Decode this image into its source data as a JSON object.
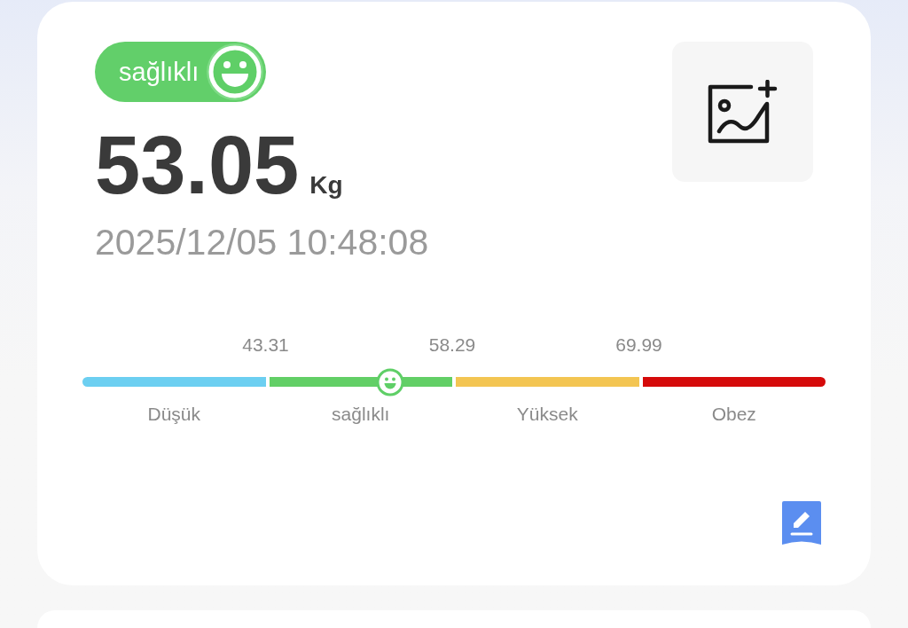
{
  "status_badge": {
    "label": "sağlıklı"
  },
  "weight": {
    "value": "53.05",
    "unit": "Kg"
  },
  "timestamp": "2025/12/05 10:48:08",
  "scale": {
    "thresholds": [
      "43.31",
      "58.29",
      "69.99"
    ],
    "segments": [
      {
        "label": "Düşük",
        "color": "#6ccff1"
      },
      {
        "label": "sağlıklı",
        "color": "#62cf66"
      },
      {
        "label": "Yüksek",
        "color": "#f3c552"
      },
      {
        "label": "Obez",
        "color": "#d50a0a"
      }
    ],
    "marker": {
      "level": 0.414
    }
  }
}
